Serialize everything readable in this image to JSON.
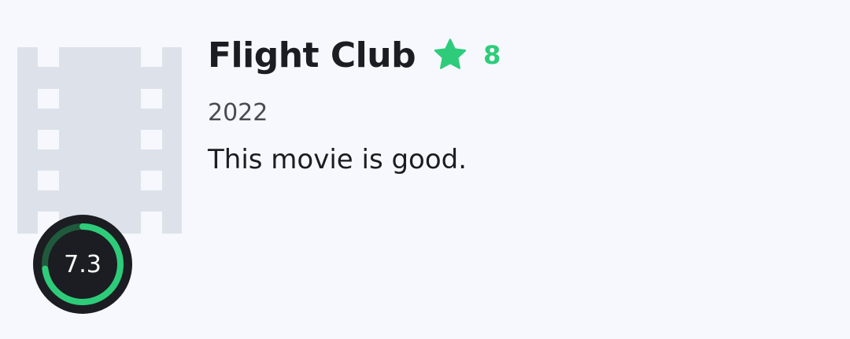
{
  "movie": {
    "title": "Flight Club",
    "user_rating": "8",
    "year": "2022",
    "overview": "This movie is good.",
    "vote_average": "7.3",
    "vote_fraction": 0.73
  },
  "icons": {
    "poster_placeholder": "film-strip-icon",
    "rating": "star-icon"
  },
  "colors": {
    "background": "#f7f8fd",
    "accent": "#2ecc7a",
    "placeholder": "#dde2ea",
    "ring_background": "#1c1d22",
    "ring_track": "#1f5a3c",
    "text_primary": "#1c1d22",
    "text_secondary": "#4a4b50"
  }
}
